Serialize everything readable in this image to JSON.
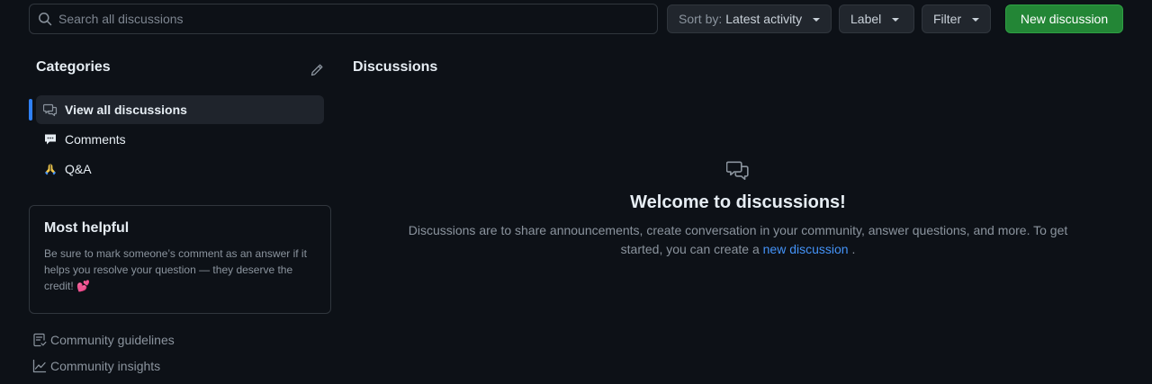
{
  "search": {
    "placeholder": "Search all discussions"
  },
  "toolbar": {
    "sort_prefix": "Sort by:",
    "sort_value": "Latest activity",
    "label": "Label",
    "filter": "Filter",
    "new_discussion": "New discussion"
  },
  "sidebar": {
    "title": "Categories",
    "items": [
      {
        "label": "View all discussions",
        "icon": "comment-discussion-icon",
        "active": true
      },
      {
        "label": "Comments",
        "icon": "speech-balloon-emoji"
      },
      {
        "label": "Q&A",
        "icon": "praying-hands-emoji"
      }
    ],
    "most_helpful": {
      "title": "Most helpful",
      "body": "Be sure to mark someone’s comment as an answer if it helps you resolve your question — they deserve the credit!",
      "emoji": "💕"
    },
    "links": [
      {
        "label": "Community guidelines",
        "icon": "checklist-icon"
      },
      {
        "label": "Community insights",
        "icon": "graph-icon"
      }
    ]
  },
  "main": {
    "title": "Discussions",
    "empty": {
      "title": "Welcome to discussions!",
      "desc_before": "Discussions are to share announcements, create conversation in your community, answer questions, and more. To get started, you can create a",
      "link": "new discussion",
      "desc_after": "."
    }
  },
  "colors": {
    "background": "#0d1117",
    "border": "#30363d",
    "accent": "#2f81f7",
    "primary_button": "#238636",
    "link": "#4493f8"
  }
}
